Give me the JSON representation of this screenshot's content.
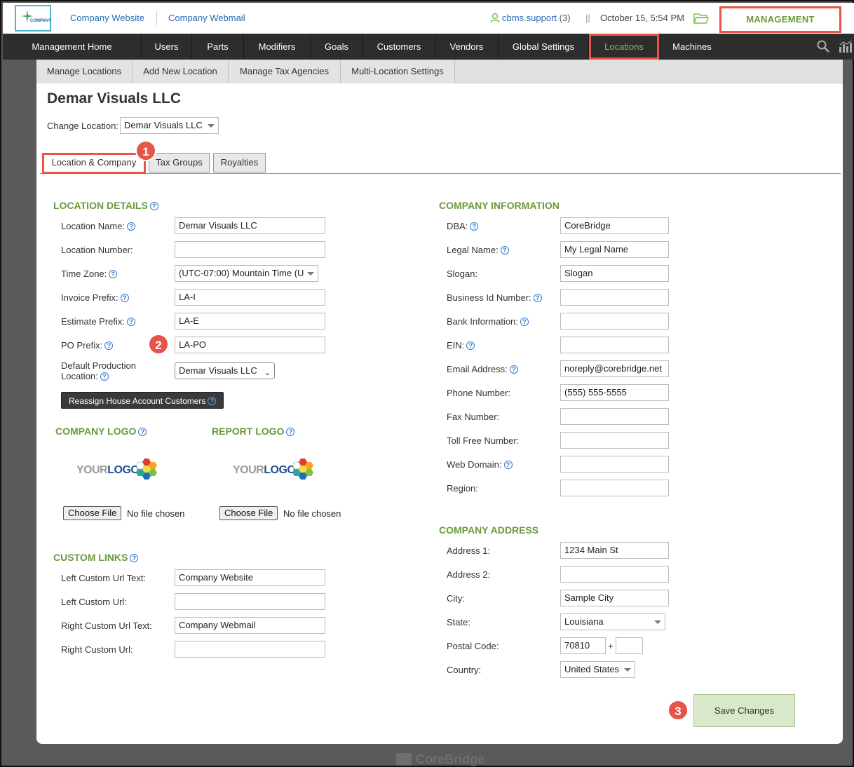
{
  "header": {
    "logo_text": "COMPANY",
    "links": [
      "Company Website",
      "Company Webmail"
    ],
    "user": "cbms.support",
    "user_count": "(3)",
    "separator": "||",
    "datetime": "October 15, 5:54 PM",
    "management_label": "MANAGEMENT"
  },
  "main_nav": {
    "items": [
      "Management Home",
      "Users",
      "Parts",
      "Modifiers",
      "Goals",
      "Customers",
      "Vendors",
      "Global Settings",
      "Locations",
      "Machines"
    ],
    "active": "Locations"
  },
  "sub_nav": {
    "items": [
      "Manage Locations",
      "Add New Location",
      "Manage Tax Agencies",
      "Multi-Location Settings"
    ]
  },
  "page": {
    "title": "Demar Visuals LLC",
    "change_location_label": "Change Location:",
    "change_location_value": "Demar Visuals LLC"
  },
  "tabs": [
    "Location & Company",
    "Tax Groups",
    "Royalties"
  ],
  "badges": [
    "1",
    "2",
    "3"
  ],
  "location_details": {
    "heading": "LOCATION DETAILS",
    "location_name_label": "Location Name:",
    "location_name_value": "Demar Visuals LLC",
    "location_number_label": "Location Number:",
    "location_number_value": "",
    "time_zone_label": "Time Zone:",
    "time_zone_value": "(UTC-07:00) Mountain Time (U",
    "invoice_prefix_label": "Invoice Prefix:",
    "invoice_prefix_value": "LA-I",
    "estimate_prefix_label": "Estimate Prefix:",
    "estimate_prefix_value": "LA-E",
    "po_prefix_label": "PO Prefix:",
    "po_prefix_value": "LA-PO",
    "default_prod_label_1": "Default Production",
    "default_prod_label_2": "Location:",
    "default_prod_value": "Demar Visuals LLC",
    "reassign_button": "Reassign House Account Customers"
  },
  "logos": {
    "company_logo_heading": "COMPANY LOGO",
    "report_logo_heading": "REPORT LOGO",
    "placeholder_your": "YOUR",
    "placeholder_logo": "LOGO",
    "choose_file": "Choose File",
    "no_file": "No file chosen"
  },
  "custom_links": {
    "heading": "CUSTOM LINKS",
    "left_text_label": "Left Custom Url Text:",
    "left_text_value": "Company Website",
    "left_url_label": "Left Custom Url:",
    "left_url_value": "",
    "right_text_label": "Right Custom Url Text:",
    "right_text_value": "Company Webmail",
    "right_url_label": "Right Custom Url:",
    "right_url_value": ""
  },
  "company_info": {
    "heading": "COMPANY INFORMATION",
    "dba_label": "DBA:",
    "dba_value": "CoreBridge",
    "legal_name_label": "Legal Name:",
    "legal_name_value": "My Legal Name",
    "slogan_label": "Slogan:",
    "slogan_value": "Slogan",
    "business_id_label": "Business Id Number:",
    "business_id_value": "",
    "bank_info_label": "Bank Information:",
    "bank_info_value": "",
    "ein_label": "EIN:",
    "ein_value": "",
    "email_label": "Email Address:",
    "email_value": "noreply@corebridge.net",
    "phone_label": "Phone Number:",
    "phone_value": "(555) 555-5555",
    "fax_label": "Fax Number:",
    "fax_value": "",
    "toll_free_label": "Toll Free Number:",
    "toll_free_value": "",
    "web_domain_label": "Web Domain:",
    "web_domain_value": "",
    "region_label": "Region:",
    "region_value": ""
  },
  "company_address": {
    "heading": "COMPANY ADDRESS",
    "address1_label": "Address 1:",
    "address1_value": "1234 Main St",
    "address2_label": "Address 2:",
    "address2_value": "",
    "city_label": "City:",
    "city_value": "Sample City",
    "state_label": "State:",
    "state_value": "Louisiana",
    "postal_label": "Postal Code:",
    "postal_value": "70810",
    "postal_plus": "+",
    "postal_ext_value": "",
    "country_label": "Country:",
    "country_value": "United States"
  },
  "save_button": "Save Changes",
  "footer_brand": "CoreBridge",
  "colors": {
    "accent_green": "#6a9b3b",
    "highlight_red": "#e8534a",
    "nav_dark": "#2d2d2d",
    "link_blue": "#2a6ab5"
  }
}
